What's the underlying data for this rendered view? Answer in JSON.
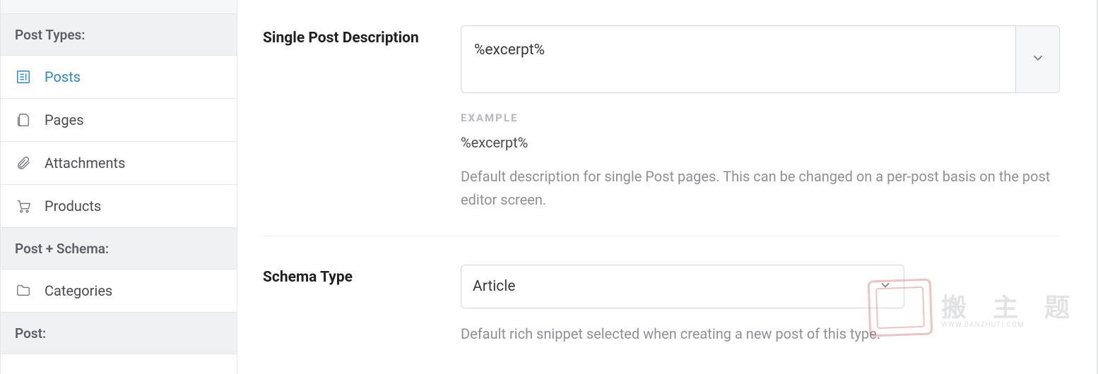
{
  "sidebar": {
    "sections": {
      "post_types_heading": "Post Types:",
      "post_schema_heading": "Post + Schema:",
      "post_heading": "Post:"
    },
    "items": {
      "posts": "Posts",
      "pages": "Pages",
      "attachments": "Attachments",
      "products": "Products",
      "categories": "Categories"
    }
  },
  "fields": {
    "single_post_description": {
      "label": "Single Post Description",
      "value": "%excerpt%",
      "example_label": "EXAMPLE",
      "example_value": "%excerpt%",
      "help": "Default description for single Post pages. This can be changed on a per-post basis on the post editor screen."
    },
    "schema_type": {
      "label": "Schema Type",
      "value": "Article",
      "help": "Default rich snippet selected when creating a new post of this type."
    }
  },
  "watermark": {
    "cn": "搬 主 题",
    "url": "WWW.BANZHUTI.COM"
  }
}
